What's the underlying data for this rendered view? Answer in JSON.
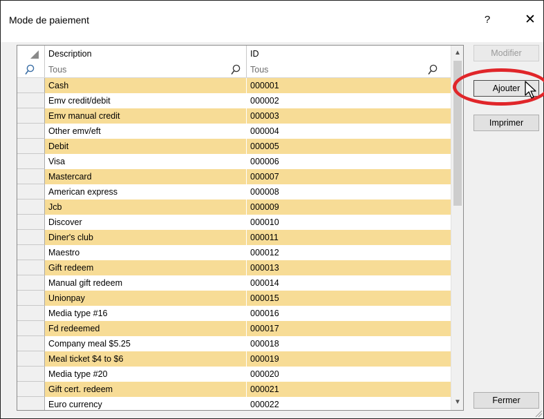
{
  "window": {
    "title": "Mode de paiement",
    "help_label": "?",
    "close_label": "✕"
  },
  "grid": {
    "columns": [
      "Description",
      "ID"
    ],
    "filter_values": [
      "Tous",
      "Tous"
    ],
    "rows": [
      {
        "description": "Cash",
        "id": "000001"
      },
      {
        "description": "Emv credit/debit",
        "id": "000002"
      },
      {
        "description": "Emv manual credit",
        "id": "000003"
      },
      {
        "description": "Other emv/eft",
        "id": "000004"
      },
      {
        "description": "Debit",
        "id": "000005"
      },
      {
        "description": "Visa",
        "id": "000006"
      },
      {
        "description": "Mastercard",
        "id": "000007"
      },
      {
        "description": "American express",
        "id": "000008"
      },
      {
        "description": "Jcb",
        "id": "000009"
      },
      {
        "description": "Discover",
        "id": "000010"
      },
      {
        "description": "Diner's club",
        "id": "000011"
      },
      {
        "description": "Maestro",
        "id": "000012"
      },
      {
        "description": "Gift redeem",
        "id": "000013"
      },
      {
        "description": "Manual gift redeem",
        "id": "000014"
      },
      {
        "description": "Unionpay",
        "id": "000015"
      },
      {
        "description": "Media type #16",
        "id": "000016"
      },
      {
        "description": "Fd redeemed",
        "id": "000017"
      },
      {
        "description": "Company meal $5.25",
        "id": "000018"
      },
      {
        "description": "Meal ticket $4 to $6",
        "id": "000019"
      },
      {
        "description": "Media type #20",
        "id": "000020"
      },
      {
        "description": "Gift cert. redeem",
        "id": "000021"
      },
      {
        "description": "Euro currency",
        "id": "000022"
      }
    ],
    "scroll_up_label": "▲",
    "scroll_down_label": "▼"
  },
  "buttons": {
    "modify": "Modifier",
    "add": "Ajouter",
    "print": "Imprimer",
    "close": "Fermer"
  },
  "colors": {
    "alt_row": "#f7dc96",
    "highlight": "#e0262a"
  }
}
